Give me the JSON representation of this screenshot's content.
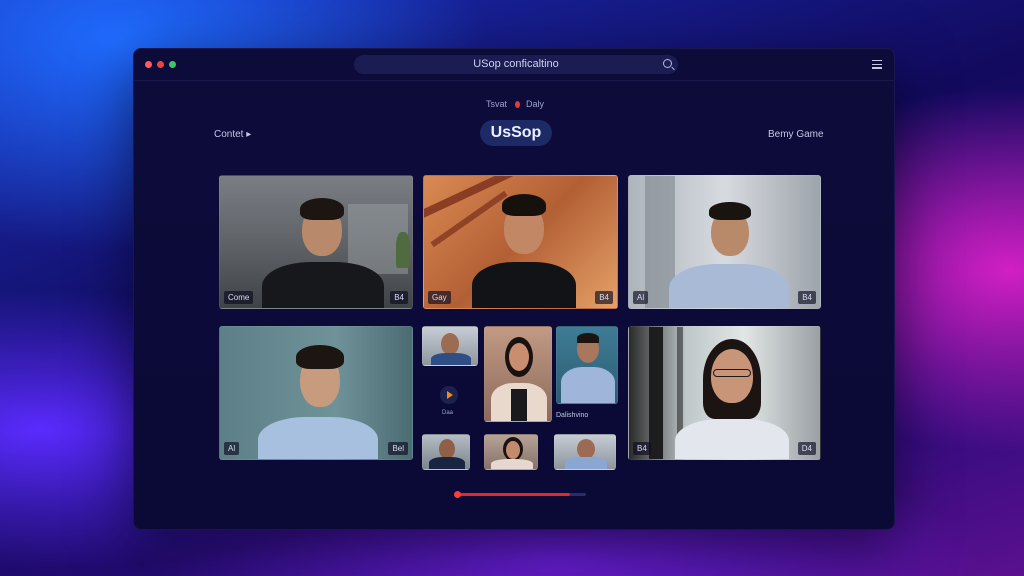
{
  "window": {
    "title": "USop conficaltino"
  },
  "toggle": {
    "left": "Tsvat",
    "right": "Daly"
  },
  "nav": {
    "left": "Contet ▸",
    "brand": "UsSop",
    "right": "Bemy Game"
  },
  "tiles": [
    {
      "left_label": "Come",
      "right_label": "B4"
    },
    {
      "left_label": "Gay",
      "right_label": "B4"
    },
    {
      "left_label": "Al",
      "right_label": "B4"
    },
    {
      "left_label": "Al",
      "right_label": "Bel"
    },
    {
      "left_label": "B4",
      "right_label": "D4"
    }
  ],
  "center_grid": {
    "play_caption": "Daa",
    "participant_caption": "Dalishvino"
  },
  "progress": {
    "value": 0.88
  },
  "colors": {
    "accent_red": "#e02a2a",
    "brand_pill": "#1d2a66",
    "window_bg": "#0c0b3a"
  },
  "icons": [
    "close-dot",
    "minimize-dot",
    "maximize-dot",
    "search-icon",
    "menu-icon",
    "record-dot-icon",
    "play-icon"
  ]
}
